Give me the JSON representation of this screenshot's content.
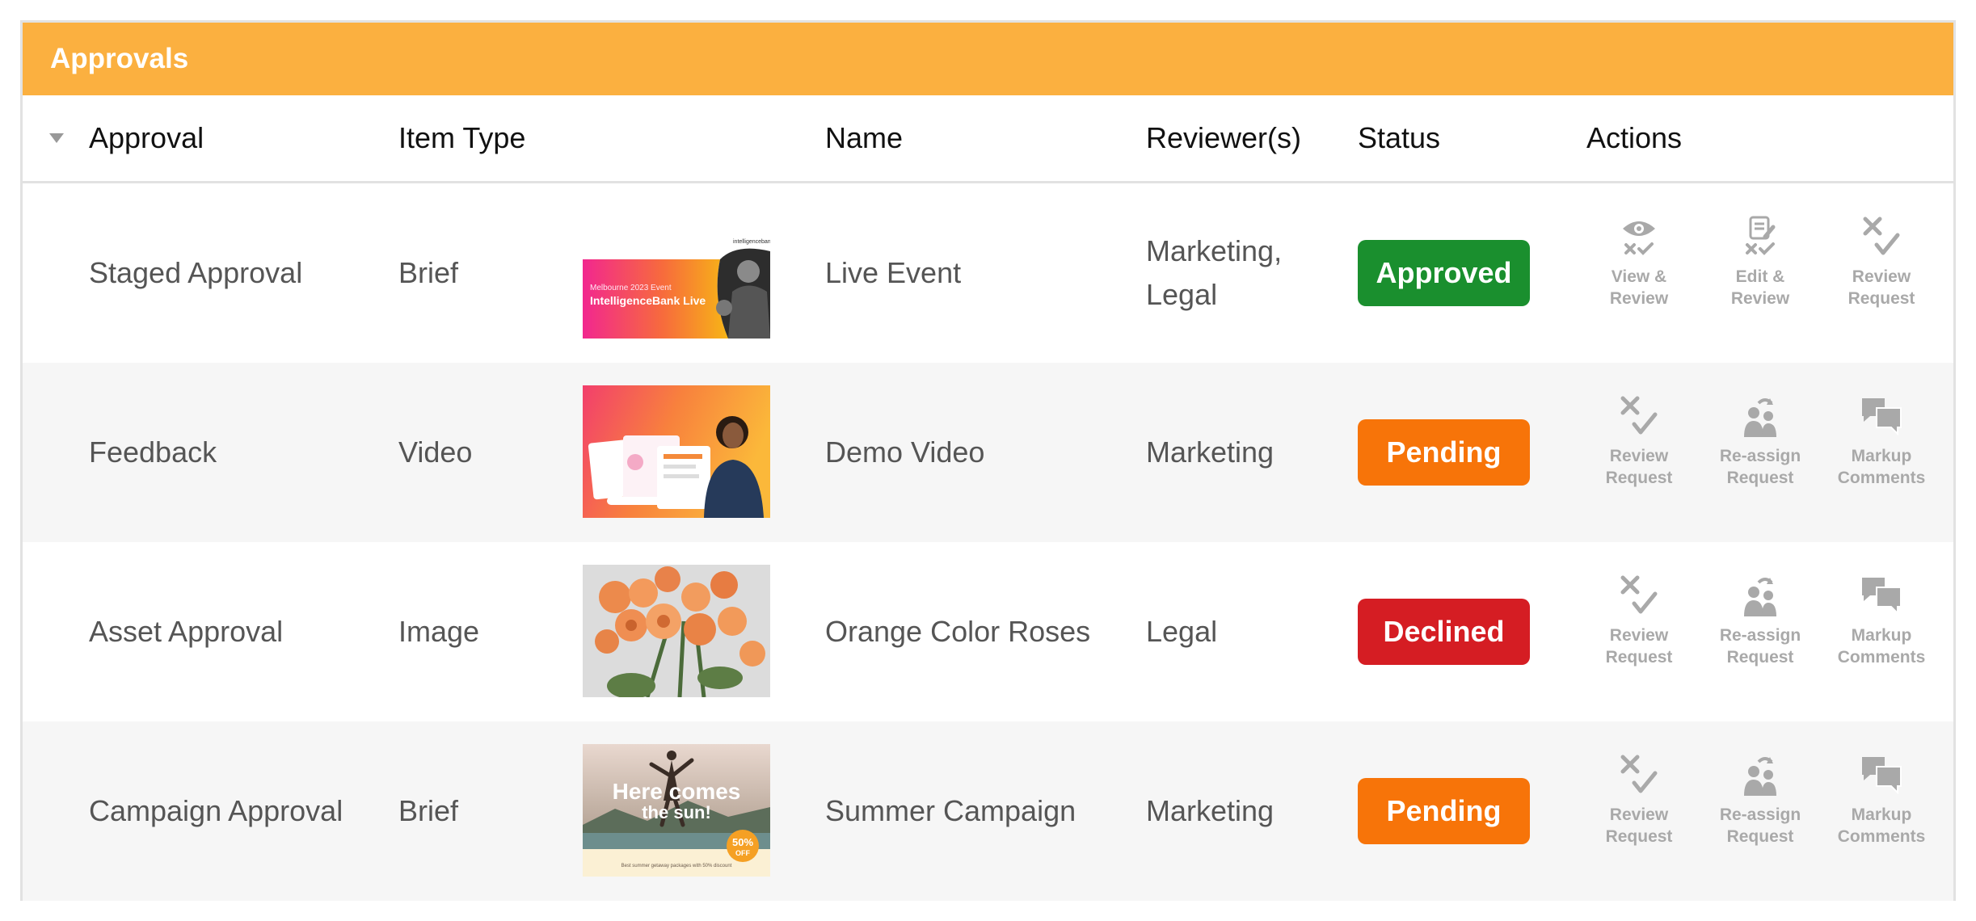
{
  "panel": {
    "title": "Approvals"
  },
  "columns": {
    "approval": "Approval",
    "item_type": "Item Type",
    "name": "Name",
    "reviewers": "Reviewer(s)",
    "status": "Status",
    "actions": "Actions"
  },
  "status_colors": {
    "Approved": "#1a8f2e",
    "Pending": "#f77409",
    "Declined": "#d51d23"
  },
  "rows": [
    {
      "approval": "Staged Approval",
      "item_type": "Brief",
      "thumb": {
        "brand": "intelligencebank",
        "event": "Melbourne 2023 Event",
        "headline": "IntelligenceBank Live"
      },
      "name": "Live Event",
      "reviewers": "Marketing,\nLegal",
      "status": "Approved",
      "actions": [
        {
          "icon": "eye-review-icon",
          "label": "View &\nReview"
        },
        {
          "icon": "edit-review-icon",
          "label": "Edit &\nReview"
        },
        {
          "icon": "review-request-icon",
          "label": "Review\nRequest"
        }
      ]
    },
    {
      "approval": "Feedback",
      "item_type": "Video",
      "thumb": {},
      "name": "Demo Video",
      "reviewers": "Marketing",
      "status": "Pending",
      "actions": [
        {
          "icon": "review-request-icon",
          "label": "Review\nRequest"
        },
        {
          "icon": "reassign-request-icon",
          "label": "Re-assign\nRequest"
        },
        {
          "icon": "markup-comments-icon",
          "label": "Markup\nComments"
        }
      ]
    },
    {
      "approval": "Asset Approval",
      "item_type": "Image",
      "thumb": {},
      "name": "Orange Color Roses",
      "reviewers": "Legal",
      "status": "Declined",
      "actions": [
        {
          "icon": "review-request-icon",
          "label": "Review\nRequest"
        },
        {
          "icon": "reassign-request-icon",
          "label": "Re-assign\nRequest"
        },
        {
          "icon": "markup-comments-icon",
          "label": "Markup\nComments"
        }
      ]
    },
    {
      "approval": "Campaign Approval",
      "item_type": "Brief",
      "thumb": {
        "headline_1": "Here comes",
        "headline_2": "the sun!",
        "discount": "50%",
        "discount_sub": "OFF",
        "tagline": "Best summer getaway packages with 50% discount"
      },
      "name": "Summer Campaign",
      "reviewers": "Marketing",
      "status": "Pending",
      "actions": [
        {
          "icon": "review-request-icon",
          "label": "Review\nRequest"
        },
        {
          "icon": "reassign-request-icon",
          "label": "Re-assign\nRequest"
        },
        {
          "icon": "markup-comments-icon",
          "label": "Markup\nComments"
        }
      ]
    }
  ]
}
